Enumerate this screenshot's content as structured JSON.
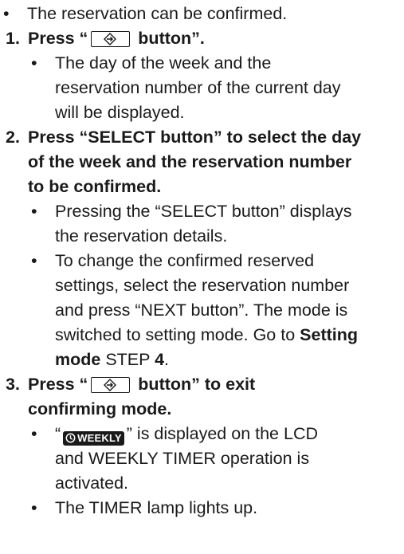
{
  "intro": "The reservation can be confirmed.",
  "step1": {
    "number": "1.",
    "prefix": "Press “",
    "suffix": "button”.",
    "button_icon": "enter-arrow-icon",
    "bullet1": [
      "The day of the week and the",
      "reservation number of the current day",
      "will be displayed."
    ]
  },
  "step2": {
    "number": "2.",
    "lines": [
      "Press “SELECT button” to select the day",
      "of the week and the reservation number",
      "to be confirmed."
    ],
    "bullet1": [
      "Pressing the “SELECT button” displays",
      "the reservation details."
    ],
    "bullet2_lines": [
      "To change the confirmed reserved",
      "settings, select the reservation number",
      "and press “NEXT button”. The mode is"
    ],
    "bullet2_line4_text": "switched to setting mode. Go to ",
    "bullet2_line4_bold": "Setting",
    "bullet2_line5_bold": "mode",
    "bullet2_line5_text": " STEP ",
    "bullet2_line5_step": "4",
    "bullet2_line5_end": "."
  },
  "step3": {
    "number": "3.",
    "prefix": "Press “",
    "suffix": "button” to exit",
    "line2": "confirming mode.",
    "bullet1_open": "“",
    "lcd_label": "WEEKLY",
    "lcd_icon": "clock-icon",
    "bullet1_close": "” is displayed on the LCD",
    "bullet1_more": [
      "and WEEKLY TIMER operation is",
      "activated."
    ],
    "bullet2": "The TIMER lamp lights up."
  }
}
